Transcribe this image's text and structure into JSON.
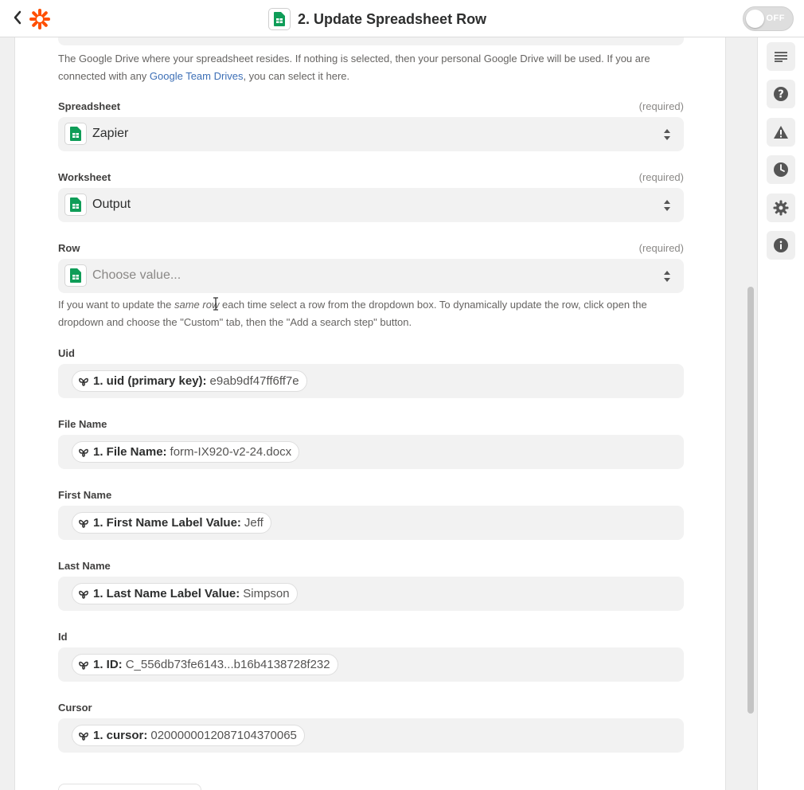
{
  "header": {
    "title": "2. Update Spreadsheet Row",
    "toggle_label": "OFF",
    "back_icon": "chevron-left-icon",
    "logo_icon": "zapier-logo-icon",
    "app_icon": "google-sheets-icon"
  },
  "drive_help": {
    "part1": "The Google Drive where your spreadsheet resides. If nothing is selected, then your personal Google Drive will be used. If you are connected with any ",
    "link": "Google Team Drives",
    "part2": ", you can select it here."
  },
  "spreadsheet": {
    "label": "Spreadsheet",
    "required": "(required)",
    "value": "Zapier"
  },
  "worksheet": {
    "label": "Worksheet",
    "required": "(required)",
    "value": "Output"
  },
  "row": {
    "label": "Row",
    "required": "(required)",
    "placeholder": "Choose value..."
  },
  "row_help": {
    "part1": "If you want to update the ",
    "em": "same row",
    "part2": " each time select a row from the dropdown box. To dynamically update the row, click open the dropdown and choose the \"Custom\" tab, then the \"Add a search step\" button."
  },
  "fields": [
    {
      "label": "Uid",
      "key": "1. uid (primary key):",
      "value": "e9ab9df47ff6ff7e"
    },
    {
      "label": "File Name",
      "key": "1. File Name:",
      "value": "form-IX920-v2-24.docx"
    },
    {
      "label": "First Name",
      "key": "1. First Name Label Value:",
      "value": "Jeff"
    },
    {
      "label": "Last Name",
      "key": "1. Last Name Label Value:",
      "value": "Simpson"
    },
    {
      "label": "Id",
      "key": "1. ID:",
      "value": "C_556db73fe6143...b16b4138728f232"
    },
    {
      "label": "Cursor",
      "key": "1. cursor:",
      "value": "0200000012087104370065"
    }
  ],
  "rail_icons": [
    "list-icon",
    "help-icon",
    "warning-icon",
    "clock-icon",
    "gear-icon",
    "info-icon"
  ],
  "colors": {
    "accent_link": "#3d6fb6",
    "zapier_orange": "#ff4f00",
    "sheets_green": "#0f9d58"
  }
}
